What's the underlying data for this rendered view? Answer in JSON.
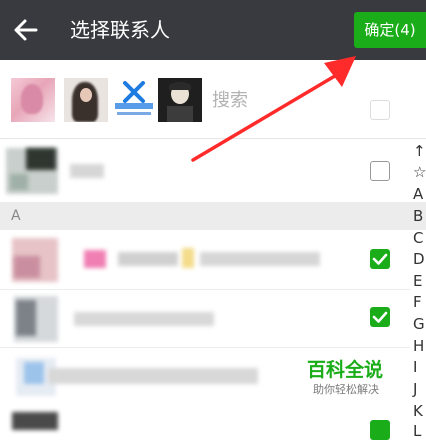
{
  "topbar": {
    "title": "选择联系人",
    "confirm_label": "确定(4)",
    "back_icon": "back-arrow-icon"
  },
  "selected_bar": {
    "search_placeholder": "搜索"
  },
  "section": {
    "label": "A"
  },
  "index_letters": [
    "↑",
    "☆",
    "A",
    "B",
    "C",
    "D",
    "E",
    "F",
    "G",
    "H",
    "I",
    "J",
    "K",
    "L"
  ],
  "contacts": [
    {
      "checked": false
    },
    {
      "checked": true
    },
    {
      "checked": true
    },
    {
      "checked": false
    },
    {
      "checked": true
    }
  ],
  "watermark": {
    "title": "百科全说",
    "subtitle": "助你轻松解决"
  },
  "colors": {
    "topbar": "#393a3f",
    "accent": "#1aad19",
    "section_bg": "#ececec",
    "annotation": "#ff2b2b"
  }
}
